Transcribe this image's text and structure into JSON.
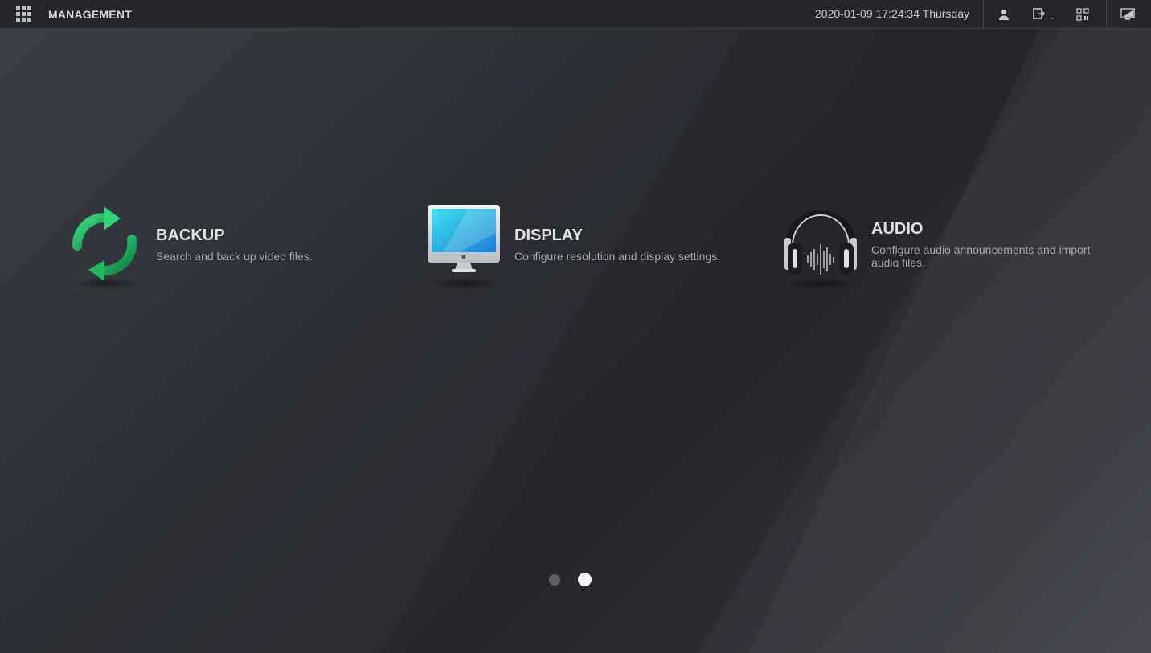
{
  "header": {
    "title": "MANAGEMENT",
    "datetime": "2020-01-09 17:24:34 Thursday",
    "icons": [
      "grid-menu-icon",
      "user-icon",
      "logout-icon",
      "qr-code-icon",
      "display-switch-icon"
    ]
  },
  "tiles": [
    {
      "title": "BACKUP",
      "description": "Search and back up video files.",
      "icon": "backup-sync-icon"
    },
    {
      "title": "DISPLAY",
      "description": "Configure resolution and display settings.",
      "icon": "monitor-icon"
    },
    {
      "title": "AUDIO",
      "description": "Configure audio announcements and import audio files.",
      "icon": "headphones-icon"
    }
  ],
  "pagination": {
    "pages": 2,
    "current": 2
  },
  "colors": {
    "accent_green": "#2fc46e",
    "screen_blue": "#2fb8e8",
    "topbar": "#25262b"
  }
}
